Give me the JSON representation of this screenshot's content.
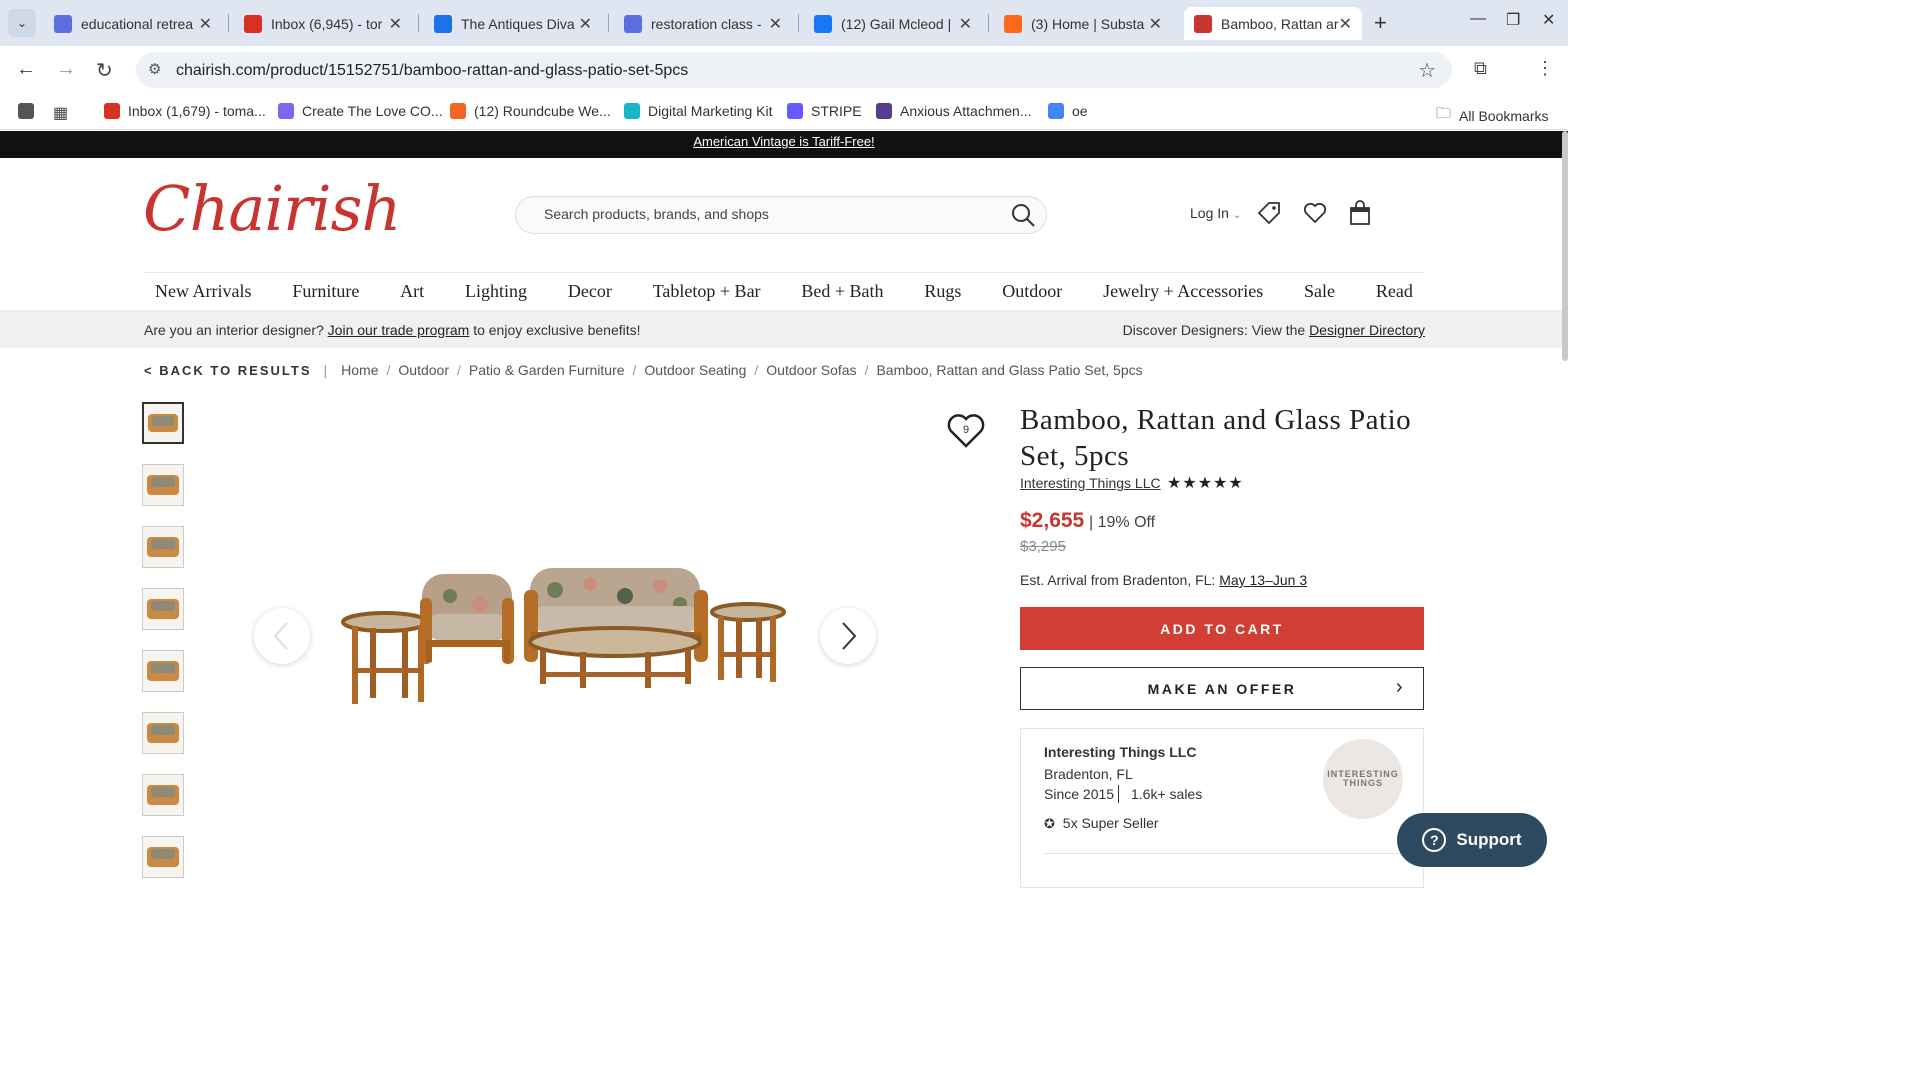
{
  "browser": {
    "tabs": [
      {
        "title": "educational retrea",
        "favicon": "meet-icon",
        "color": "#5b6fe0"
      },
      {
        "title": "Inbox (6,945) - tor",
        "favicon": "gmail-icon",
        "color": "#d93025"
      },
      {
        "title": "The Antiques Diva",
        "favicon": "calendar-icon",
        "color": "#1a73e8"
      },
      {
        "title": "restoration class -",
        "favicon": "meet-icon",
        "color": "#5b6fe0"
      },
      {
        "title": "(12) Gail Mcleod |",
        "favicon": "facebook-icon",
        "color": "#1877f2"
      },
      {
        "title": "(3) Home | Substa",
        "favicon": "substack-icon",
        "color": "#ff6719"
      },
      {
        "title": "Bamboo, Rattan ar",
        "favicon": "chairish-icon",
        "color": "#c8342f",
        "active": true
      }
    ],
    "url": "chairish.com/product/15152751/bamboo-rattan-and-glass-patio-set-5pcs",
    "bookmarks": [
      {
        "label": "Inbox (1,679) - toma...",
        "icon": "gmail-icon",
        "color": "#d93025"
      },
      {
        "label": "Create The Love CO...",
        "icon": "circle-icon",
        "color": "#7b68ee"
      },
      {
        "label": "(12) Roundcube We...",
        "icon": "roundcube-icon",
        "color": "#f26522"
      },
      {
        "label": "Digital Marketing Kit",
        "icon": "kit-icon",
        "color": "#17b6c8"
      },
      {
        "label": "STRIPE",
        "icon": "stripe-icon",
        "color": "#635bff"
      },
      {
        "label": "Anxious Attachmen...",
        "icon": "a-icon",
        "color": "#5a3c8c"
      },
      {
        "label": "oe",
        "icon": "google-icon",
        "color": "#4285f4"
      }
    ],
    "all_bookmarks": "All Bookmarks"
  },
  "site": {
    "promo": "American Vintage is Tariff-Free!",
    "logo": "Chairish",
    "search_placeholder": "Search products, brands, and shops",
    "login": "Log In",
    "nav": [
      "New Arrivals",
      "Furniture",
      "Art",
      "Lighting",
      "Decor",
      "Tabletop + Bar",
      "Bed + Bath",
      "Rugs",
      "Outdoor",
      "Jewelry + Accessories",
      "Sale",
      "Read"
    ],
    "trade": {
      "prefix": "Are you an interior designer?",
      "link": "Join our trade program",
      "suffix": "to enjoy exclusive benefits!",
      "designers_prefix": "Discover Designers: View the",
      "designers_link": "Designer Directory"
    },
    "breadcrumb": {
      "back": "< BACK TO RESULTS",
      "items": [
        "Home",
        "Outdoor",
        "Patio & Garden Furniture",
        "Outdoor Seating",
        "Outdoor Sofas",
        "Bamboo, Rattan and Glass Patio Set, 5pcs"
      ]
    }
  },
  "product": {
    "title": "Bamboo, Rattan and Glass Patio Set, 5pcs",
    "favorites_count": "9",
    "seller": "Interesting Things LLC",
    "rating_stars": "★★★★★",
    "price": "$2,655",
    "discount": "19% Off",
    "original_price": "$3,295",
    "arrival_prefix": "Est. Arrival from Bradenton, FL:",
    "arrival_dates": "May 13–Jun 3",
    "add_to_cart": "ADD TO CART",
    "make_offer": "MAKE AN OFFER",
    "thumbnail_count": 8
  },
  "seller_card": {
    "name": "Interesting Things LLC",
    "location": "Bradenton, FL",
    "since": "Since 2015",
    "sales": "1.6k+ sales",
    "badge": "5x Super Seller",
    "avatar_text": "INTERESTING THINGS"
  },
  "support": "Support",
  "colors": {
    "brand": "#c8342f",
    "support": "#2e4a61"
  }
}
